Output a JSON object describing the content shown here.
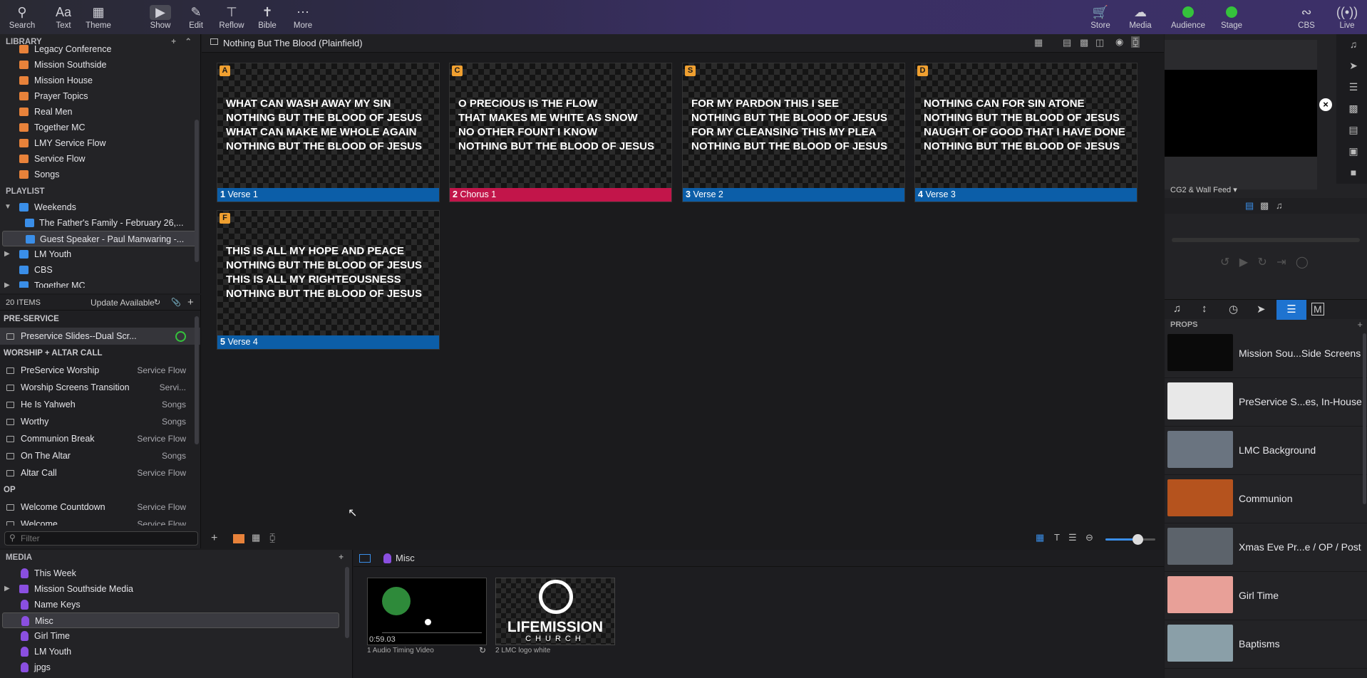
{
  "toolbar": {
    "left": [
      {
        "label": "Search",
        "icon": "search-icon"
      },
      {
        "label": "Text",
        "icon": "text-icon"
      },
      {
        "label": "Theme",
        "icon": "theme-icon"
      },
      {
        "label": "Show",
        "icon": "play-icon"
      },
      {
        "label": "Edit",
        "icon": "pencil-icon"
      },
      {
        "label": "Reflow",
        "icon": "reflow-icon"
      },
      {
        "label": "Bible",
        "icon": "bible-icon"
      },
      {
        "label": "More",
        "icon": "more-icon"
      }
    ],
    "right": [
      {
        "label": "Store",
        "icon": "cart-icon"
      },
      {
        "label": "Media",
        "icon": "media-icon"
      },
      {
        "label": "Audience",
        "icon": "status-dot-icon"
      },
      {
        "label": "Stage",
        "icon": "status-dot-icon"
      },
      {
        "label": "CBS",
        "icon": "mustache-icon"
      },
      {
        "label": "Live",
        "icon": "broadcast-icon"
      }
    ],
    "status_color": "#35c23c"
  },
  "library": {
    "header": "LIBRARY",
    "items": [
      "Legacy Conference",
      "Mission Southside",
      "Mission House",
      "Prayer Topics",
      "Real Men",
      "Together MC",
      "LMY Service Flow",
      "Service Flow",
      "Songs"
    ]
  },
  "playlist": {
    "header": "PLAYLIST",
    "items": [
      {
        "label": "Weekends",
        "type": "folder",
        "expanded": true
      },
      {
        "label": "The Father's Family - February 26,...",
        "type": "presentation"
      },
      {
        "label": "Guest Speaker - Paul Manwaring -...",
        "type": "presentation",
        "selected": true
      },
      {
        "label": "LM Youth",
        "type": "folder"
      },
      {
        "label": "CBS",
        "type": "list"
      },
      {
        "label": "Together MC",
        "type": "folder"
      }
    ]
  },
  "items_panel": {
    "count": "20 ITEMS",
    "update": "Update Available",
    "groups": [
      {
        "name": "PRE-SERVICE",
        "rows": [
          {
            "title": "Preservice Slides--Dual Scr...",
            "category": ""
          }
        ]
      },
      {
        "name": "WORSHIP + ALTAR CALL",
        "rows": [
          {
            "title": "PreService Worship",
            "category": "Service Flow"
          },
          {
            "title": "Worship Screens Transition",
            "category": "Servi..."
          },
          {
            "title": "He Is Yahweh",
            "category": "Songs"
          },
          {
            "title": "Worthy",
            "category": "Songs"
          },
          {
            "title": "Communion Break",
            "category": "Service Flow"
          },
          {
            "title": "On The Altar",
            "category": "Songs"
          },
          {
            "title": "Altar Call",
            "category": "Service Flow"
          }
        ]
      },
      {
        "name": "OP",
        "rows": [
          {
            "title": "Welcome Countdown",
            "category": "Service Flow"
          },
          {
            "title": "Welcome",
            "category": "Service Flow"
          }
        ]
      }
    ],
    "filter_placeholder": "Filter"
  },
  "document": {
    "title": "Nothing But The Blood (Plainfield)",
    "slides": [
      {
        "key": "A",
        "num": "1",
        "label": "Verse 1",
        "color": "blue",
        "text": "WHAT CAN WASH AWAY MY SIN\nNOTHING BUT THE BLOOD OF JESUS\nWHAT CAN MAKE ME WHOLE AGAIN\nNOTHING BUT THE BLOOD OF JESUS"
      },
      {
        "key": "C",
        "num": "2",
        "label": "Chorus 1",
        "color": "red",
        "text": "O PRECIOUS IS THE FLOW\nTHAT MAKES ME WHITE AS SNOW\nNO OTHER FOUNT I KNOW\nNOTHING BUT THE BLOOD OF JESUS"
      },
      {
        "key": "S",
        "num": "3",
        "label": "Verse 2",
        "color": "blue",
        "text": "FOR MY PARDON THIS I SEE\nNOTHING BUT THE BLOOD OF JESUS\nFOR MY CLEANSING THIS MY PLEA\nNOTHING BUT THE BLOOD OF JESUS"
      },
      {
        "key": "D",
        "num": "4",
        "label": "Verse 3",
        "color": "blue",
        "text": "NOTHING CAN FOR SIN ATONE\nNOTHING BUT THE BLOOD OF JESUS\nNAUGHT OF GOOD THAT I HAVE DONE\nNOTHING BUT THE BLOOD OF JESUS"
      },
      {
        "key": "F",
        "num": "5",
        "label": "Verse 4",
        "color": "blue",
        "text": "THIS IS ALL MY HOPE AND PEACE\nNOTHING BUT THE BLOOD OF JESUS\nTHIS IS ALL MY RIGHTEOUSNESS\nNOTHING BUT THE BLOOD OF JESUS"
      }
    ]
  },
  "media": {
    "header": "MEDIA",
    "items": [
      "This Week",
      "Mission Southside Media",
      "Name Keys",
      "Misc",
      "Girl Time",
      "LM Youth",
      "jpgs"
    ],
    "selected": "Misc",
    "bin_title": "Misc",
    "bin_items": [
      {
        "num": "1",
        "name": "Audio Timing Video",
        "time": "0:59.03"
      },
      {
        "num": "2",
        "name": "LMC logo white",
        "logo_top": "LIFEMISSION",
        "logo_bottom": "CHURCH"
      }
    ]
  },
  "right": {
    "output_label": "CG2 & Wall Feed",
    "props_header": "PROPS",
    "props": [
      {
        "name": "Mission Sou...Side Screens",
        "bg": "#0a0a0a"
      },
      {
        "name": "PreService S...es, In-House",
        "bg": "#e8e8e8"
      },
      {
        "name": "LMC Background",
        "bg": "#6a7480"
      },
      {
        "name": "Communion",
        "bg": "#b5531e"
      },
      {
        "name": "Xmas Eve Pr...e / OP / Post",
        "bg": "#5c636b"
      },
      {
        "name": "Girl Time",
        "bg": "#e8a098"
      },
      {
        "name": "Baptisms",
        "bg": "#8a9fa8"
      }
    ]
  }
}
